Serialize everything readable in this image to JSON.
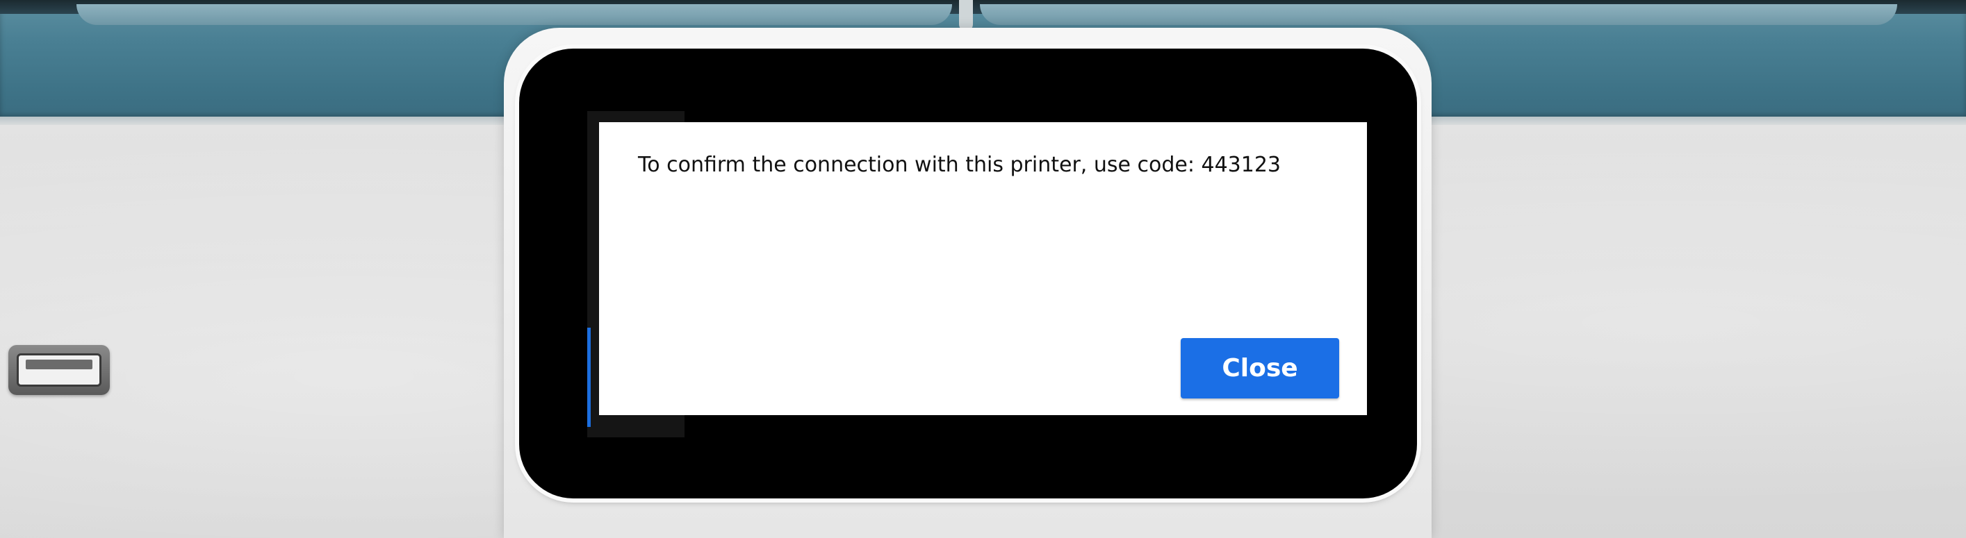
{
  "dialog": {
    "message": "To confirm the connection with this printer, use code: 443123",
    "close_label": "Close"
  },
  "colors": {
    "accent": "#1b6fe6",
    "screen_background": "#000000",
    "dialog_background": "#ffffff",
    "lid": "#497f93"
  },
  "icons": {
    "usb_port": "usb-port-icon"
  }
}
